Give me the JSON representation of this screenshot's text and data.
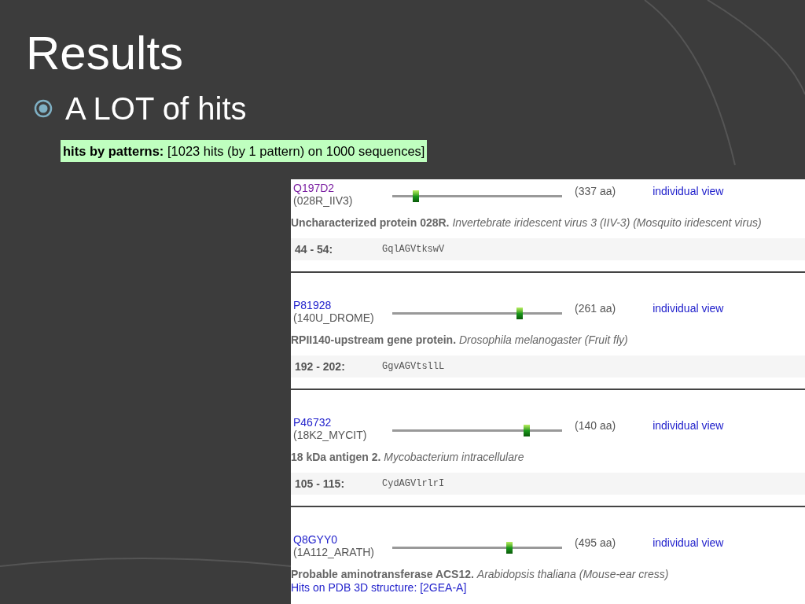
{
  "slide": {
    "title": "Results",
    "bullets": [
      {
        "text": "A LOT of hits"
      }
    ]
  },
  "summary": "**hits by patterns:** [1023 hits (by 1 pattern) on 1000 sequences]",
  "hits": [
    {
      "accession": "Q197D2",
      "visited": true,
      "entry_name": "(028R_IIV3)",
      "track": {
        "hit": {
          "level": 0.14
        }
      },
      "length": "(337 aa)",
      "link": "individual view",
      "description": "**Uncharacterized protein 028R.**  *Invertebrate iridescent virus 3 (IIV-3) (Mosquito iridescent virus)*",
      "range": "44 - 54:",
      "sequence": "GqlAGVtkswV"
    },
    {
      "accession": "P81928",
      "visited": false,
      "entry_name": "(140U_DROME)",
      "track": {
        "hit": {
          "level": 0.75
        }
      },
      "length": "(261 aa)",
      "link": "individual view",
      "description": "**RPII140-upstream gene protein.**  *Drosophila melanogaster (Fruit fly)*",
      "range": "192 - 202:",
      "sequence": "GgvAGVtsllL"
    },
    {
      "accession": "P46732",
      "visited": false,
      "entry_name": "(18K2_MYCIT)",
      "track": {
        "hit": {
          "level": 0.79
        }
      },
      "length": "(140 aa)",
      "link": "individual view",
      "description": "**18 kDa antigen 2.**  *Mycobacterium intracellulare*",
      "range": "105 - 115:",
      "sequence": "CydAGVlrlrI"
    },
    {
      "accession": "Q8GYY0",
      "visited": false,
      "entry_name": "(1A112_ARATH)",
      "track": {
        "hit": {
          "level": 0.69
        }
      },
      "length": "(495 aa)",
      "link": "individual view",
      "description": "**Probable aminotransferase ACS12.**  *Arabidopsis thaliana (Mouse-ear cress)*",
      "pdb_link": "Hits on PDB 3D structure: [2GEA-A]"
    }
  ]
}
